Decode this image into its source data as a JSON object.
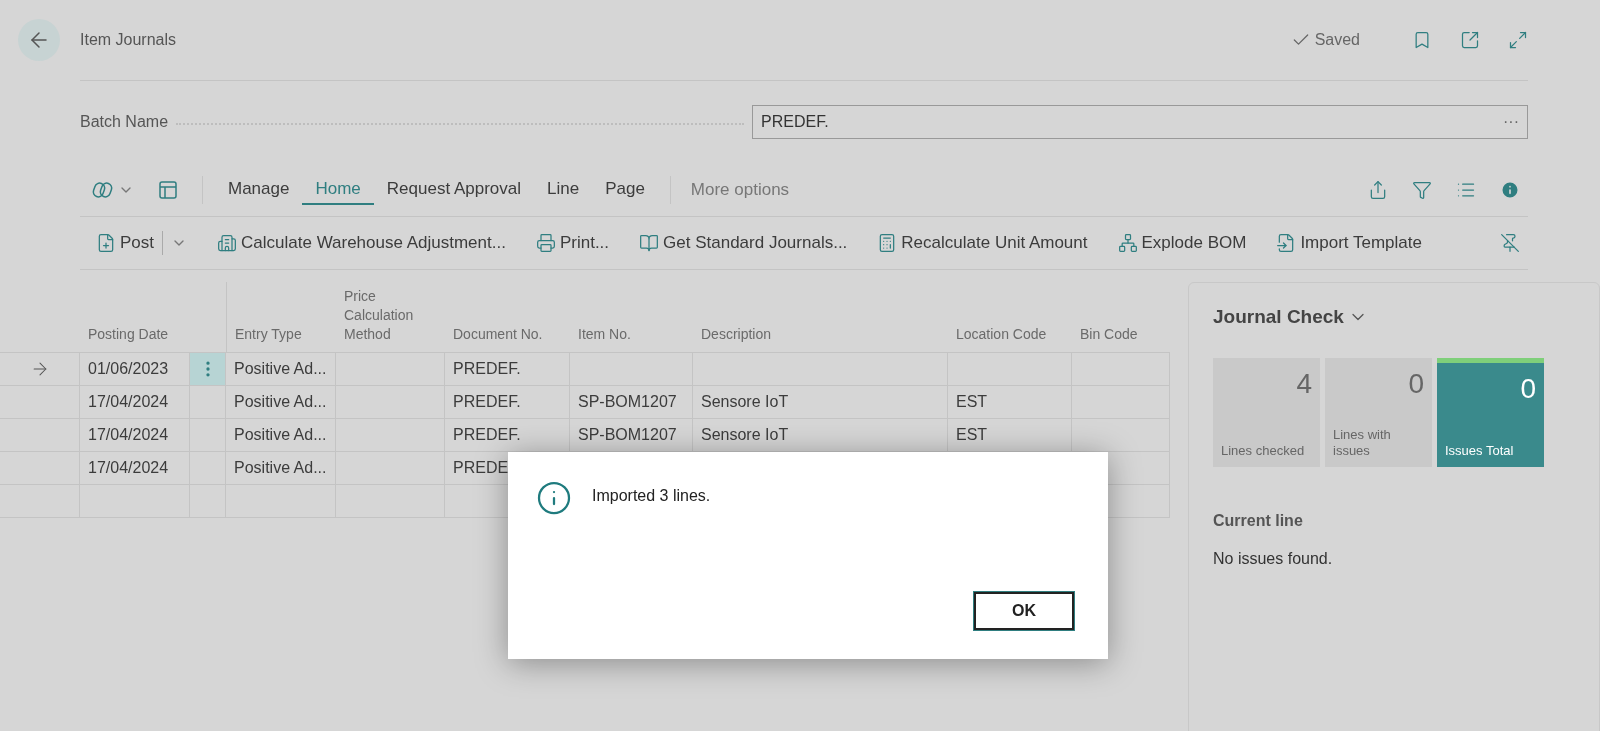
{
  "header": {
    "title": "Item Journals",
    "status": "Saved"
  },
  "batch": {
    "label": "Batch Name",
    "value": "PREDEF.",
    "more": "···"
  },
  "nav_tabs": [
    {
      "label": "Manage",
      "selected": false
    },
    {
      "label": "Home",
      "selected": true
    },
    {
      "label": "Request Approval",
      "selected": false
    },
    {
      "label": "Line",
      "selected": false
    },
    {
      "label": "Page",
      "selected": false
    }
  ],
  "more_options": "More options",
  "actions": [
    {
      "kind": "post",
      "label": "Post"
    },
    {
      "kind": "warehouse",
      "label": "Calculate Warehouse Adjustment..."
    },
    {
      "kind": "print",
      "label": "Print..."
    },
    {
      "kind": "standard",
      "label": "Get Standard Journals..."
    },
    {
      "kind": "recalc",
      "label": "Recalculate Unit Amount"
    },
    {
      "kind": "explode",
      "label": "Explode BOM"
    },
    {
      "kind": "import",
      "label": "Import Template"
    }
  ],
  "table": {
    "columns": [
      "Posting Date",
      "Entry Type",
      "Price Calculation Method",
      "Document No.",
      "Item No.",
      "Description",
      "Location Code",
      "Bin Code"
    ],
    "rows": [
      {
        "current": true,
        "cells": [
          "01/06/2023",
          "Positive Ad...",
          "",
          "PREDEF.",
          "",
          "",
          "",
          ""
        ]
      },
      {
        "current": false,
        "cells": [
          "17/04/2024",
          "Positive Ad...",
          "",
          "PREDEF.",
          "SP-BOM1207",
          "Sensore IoT",
          "EST",
          ""
        ]
      },
      {
        "current": false,
        "cells": [
          "17/04/2024",
          "Positive Ad...",
          "",
          "PREDEF.",
          "SP-BOM1207",
          "Sensore IoT",
          "EST",
          ""
        ]
      },
      {
        "current": false,
        "cells": [
          "17/04/2024",
          "Positive Ad...",
          "",
          "PREDE",
          null,
          null,
          null,
          ""
        ]
      },
      {
        "current": false,
        "cells": [
          "",
          "",
          "",
          "",
          null,
          null,
          null,
          ""
        ]
      }
    ]
  },
  "journal_check": {
    "title": "Journal Check",
    "tiles": [
      {
        "value": "4",
        "label": "Lines checked",
        "highlight": false
      },
      {
        "value": "0",
        "label": "Lines with issues",
        "highlight": false
      },
      {
        "value": "0",
        "label": "Issues Total",
        "highlight": true
      }
    ],
    "current_line_title": "Current line",
    "current_line_text": "No issues found."
  },
  "dialog": {
    "message": "Imported 3 lines.",
    "button": "OK"
  }
}
